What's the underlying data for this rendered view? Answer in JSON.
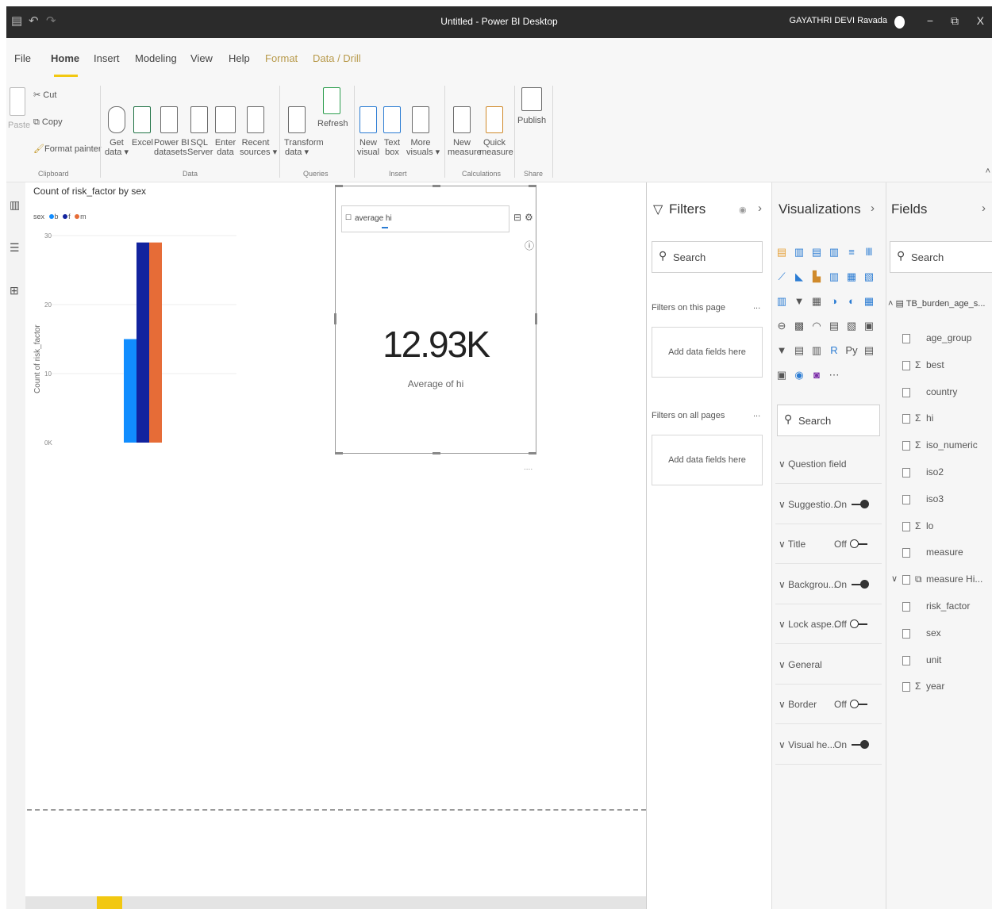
{
  "titlebar": {
    "title": "Untitled - Power BI Desktop",
    "user": "GAYATHRI DEVI Ravada",
    "save_icon": "▤",
    "undo_icon": "↶",
    "redo_icon": "↷",
    "minimize": "−",
    "restore": "⧉",
    "close": "X"
  },
  "menu": {
    "items": [
      "File",
      "Home",
      "Insert",
      "Modeling",
      "View",
      "Help",
      "Format",
      "Data / Drill"
    ]
  },
  "ribbon": {
    "clipboard": {
      "paste": "Paste",
      "cut": "Cut",
      "copy": "Copy",
      "format_painter": "Format painter",
      "group": "Clipboard"
    },
    "data": {
      "get_data": "Get\ndata ▾",
      "excel": "Excel",
      "pbi_datasets": "Power BI\ndatasets",
      "sql": "SQL\nServer",
      "enter_data": "Enter\ndata",
      "recent": "Recent\nsources ▾",
      "group": "Data"
    },
    "queries": {
      "transform": "Transform\ndata ▾",
      "refresh": "Refresh",
      "group": "Queries"
    },
    "insert": {
      "new_visual": "New\nvisual",
      "text_box": "Text\nbox",
      "more_visuals": "More\nvisuals ▾",
      "group": "Insert"
    },
    "calculations": {
      "new_measure": "New\nmeasure",
      "quick_measure": "Quick\nmeasure",
      "group": "Calculations"
    },
    "share": {
      "publish": "Publish",
      "group": "Share"
    }
  },
  "chart_data": {
    "type": "bar",
    "title": "Count of risk_factor by sex",
    "legend_title": "sex",
    "legend_items": [
      "b",
      "f",
      "m"
    ],
    "ylabel": "Count of risk_factor",
    "ylim": [
      0,
      30
    ],
    "yticks": [
      "30",
      "20",
      "10",
      "0K"
    ],
    "series": [
      {
        "name": "b",
        "values": [
          15
        ],
        "color": "#118dff"
      },
      {
        "name": "f",
        "values": [
          29
        ],
        "color": "#12239e"
      },
      {
        "name": "m",
        "values": [
          29
        ],
        "color": "#e66c37"
      }
    ]
  },
  "card": {
    "qa_text": "average hi",
    "value": "12.93K",
    "label": "Average of hi",
    "more": "...."
  },
  "filters": {
    "title": "Filters",
    "search": "Search",
    "on_this_page": "Filters on this page",
    "on_all_pages": "Filters on all pages",
    "add_fields": "Add data fields here",
    "more": "..."
  },
  "visualizations": {
    "title": "Visualizations",
    "search": "Search",
    "format": [
      {
        "label": "Question field",
        "state": ""
      },
      {
        "label": "Suggestio...",
        "state": "On"
      },
      {
        "label": "Title",
        "state": "Off"
      },
      {
        "label": "Backgrou...",
        "state": "On"
      },
      {
        "label": "Lock aspe...",
        "state": "Off"
      },
      {
        "label": "General",
        "state": ""
      },
      {
        "label": "Border",
        "state": "Off"
      },
      {
        "label": "Visual he...",
        "state": "On"
      }
    ]
  },
  "fields": {
    "title": "Fields",
    "search": "Search",
    "table": "TB_burden_age_s...",
    "items": [
      {
        "name": "age_group",
        "sigma": false
      },
      {
        "name": "best",
        "sigma": true
      },
      {
        "name": "country",
        "sigma": false
      },
      {
        "name": "hi",
        "sigma": true
      },
      {
        "name": "iso_numeric",
        "sigma": true
      },
      {
        "name": "iso2",
        "sigma": false
      },
      {
        "name": "iso3",
        "sigma": false
      },
      {
        "name": "lo",
        "sigma": true
      },
      {
        "name": "measure",
        "sigma": false
      },
      {
        "name": "measure Hi...",
        "sigma": false,
        "hier": true
      },
      {
        "name": "risk_factor",
        "sigma": false
      },
      {
        "name": "sex",
        "sigma": false
      },
      {
        "name": "unit",
        "sigma": false
      },
      {
        "name": "year",
        "sigma": true
      }
    ]
  }
}
